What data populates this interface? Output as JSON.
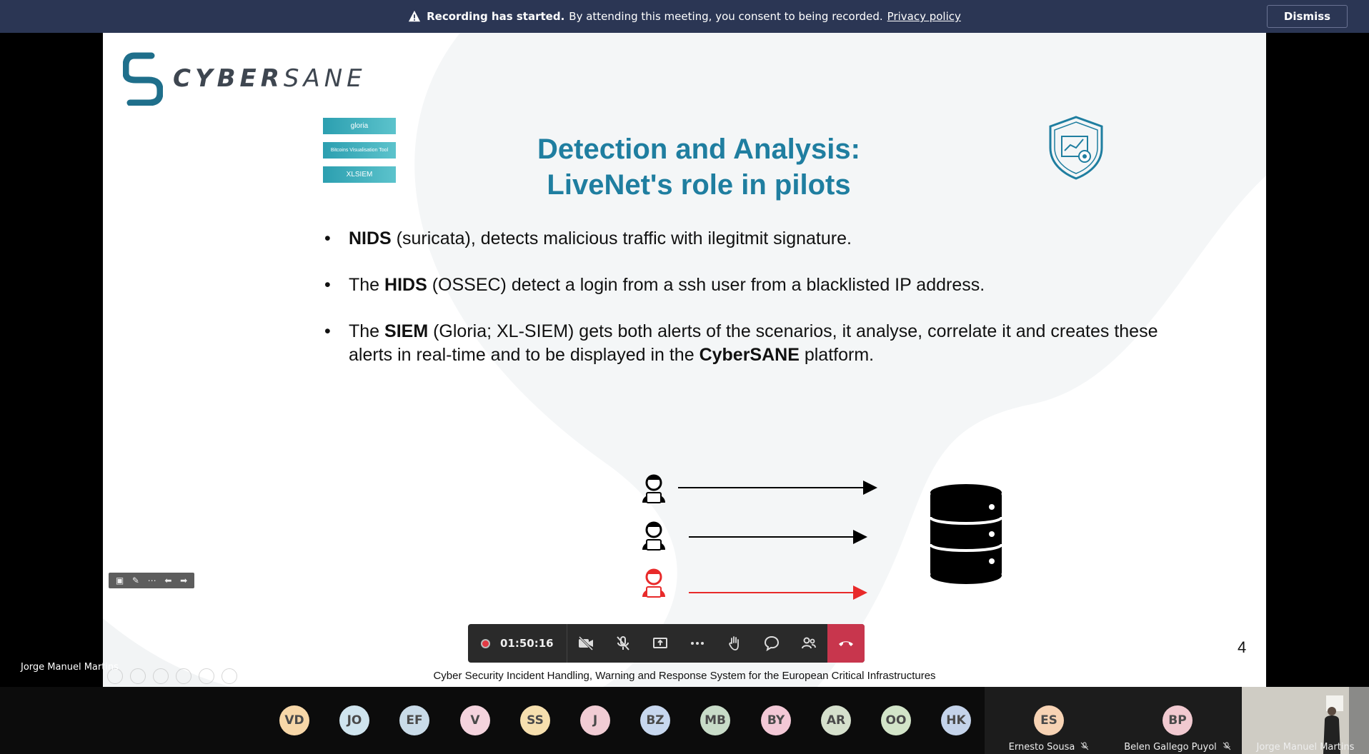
{
  "banner": {
    "bold": "Recording has started.",
    "message": "By attending this meeting, you consent to being recorded.",
    "link": "Privacy policy",
    "dismiss": "Dismiss"
  },
  "slide": {
    "logo_text_bold": "CYBER",
    "logo_text_light": "SANE",
    "tool_badges": [
      "gloria",
      "Bitcoins Visualisation Tool",
      "XLSIEM"
    ],
    "title_line1": "Detection and Analysis:",
    "title_line2": "LiveNet's role in pilots",
    "bullet1_bold": "NIDS",
    "bullet1_rest": " (suricata), detects malicious traffic with ilegitmit signature.",
    "bullet2_pre": "The ",
    "bullet2_bold": "HIDS",
    "bullet2_rest": " (OSSEC) detect a login from a ssh user from a blacklisted IP address.",
    "bullet3_pre": "The  ",
    "bullet3_bold": "SIEM",
    "bullet3_mid": " (Gloria; XL-SIEM) gets both alerts of the scenarios, it analyse, correlate it and creates these alerts in real-time and to be displayed  in the ",
    "bullet3_bold2": "CyberSANE",
    "bullet3_end": " platform.",
    "page_number": "4",
    "footer": "Cyber Security Incident Handling, Warning and Response System for the European Critical Infrastructures"
  },
  "presenter_label": "Jorge Manuel Martins",
  "call_bar": {
    "timer": "01:50:16",
    "icons": [
      "camera-off-icon",
      "mic-off-icon",
      "share-screen-icon",
      "more-icon",
      "raise-hand-icon",
      "chat-icon",
      "participants-icon",
      "hang-up-icon"
    ]
  },
  "participants": [
    {
      "initials": "VD",
      "color": "#f7d7a8"
    },
    {
      "initials": "JO",
      "color": "#cfe4ee"
    },
    {
      "initials": "EF",
      "color": "#c9dbe8"
    },
    {
      "initials": "V",
      "color": "#f4d3dd"
    },
    {
      "initials": "SS",
      "color": "#f6dfae"
    },
    {
      "initials": "J",
      "color": "#f1ccd4"
    },
    {
      "initials": "BZ",
      "color": "#c7d7ee"
    },
    {
      "initials": "MB",
      "color": "#c8dcc8"
    },
    {
      "initials": "BY",
      "color": "#f3c8d6"
    },
    {
      "initials": "AR",
      "color": "#d5e0cc"
    },
    {
      "initials": "OO",
      "color": "#d2e4c8"
    },
    {
      "initials": "HK",
      "color": "#c4d3ea"
    }
  ],
  "named_tiles": [
    {
      "initials": "ES",
      "name": "Ernesto Sousa",
      "color": "#f7d3b4"
    },
    {
      "initials": "BP",
      "name": "Belen Gallego Puyol",
      "color": "#f1c9d0"
    },
    {
      "name": "Jorge Manuel Martins"
    }
  ]
}
